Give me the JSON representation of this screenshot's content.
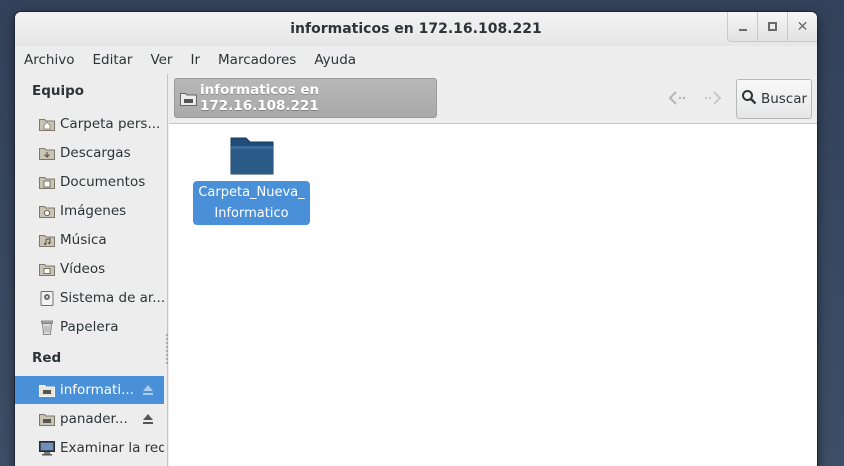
{
  "window": {
    "title": "informaticos en 172.16.108.221"
  },
  "window_controls": {
    "minimize": "–",
    "maximize": "□",
    "close": "✕"
  },
  "menu": [
    "Archivo",
    "Editar",
    "Ver",
    "Ir",
    "Marcadores",
    "Ayuda"
  ],
  "sidebar": {
    "sections": [
      {
        "title": "Equipo",
        "items": [
          {
            "label": "Carpeta pers...",
            "icon": "home-folder-icon"
          },
          {
            "label": "Descargas",
            "icon": "downloads-folder-icon"
          },
          {
            "label": "Documentos",
            "icon": "documents-folder-icon"
          },
          {
            "label": "Imágenes",
            "icon": "pictures-folder-icon"
          },
          {
            "label": "Música",
            "icon": "music-folder-icon"
          },
          {
            "label": "Vídeos",
            "icon": "videos-folder-icon"
          },
          {
            "label": "Sistema de ar...",
            "icon": "filesystem-icon"
          },
          {
            "label": "Papelera",
            "icon": "trash-icon"
          }
        ]
      },
      {
        "title": "Red",
        "items": [
          {
            "label": "informati...",
            "icon": "network-folder-icon",
            "selected": true,
            "eject": true
          },
          {
            "label": "panader...",
            "icon": "network-folder-icon",
            "selected": false,
            "eject": true
          },
          {
            "label": "Examinar la red",
            "icon": "network-browse-icon"
          }
        ]
      }
    ]
  },
  "toolbar": {
    "path_label": "informaticos en 172.16.108.221",
    "search_label": "Buscar"
  },
  "files": [
    {
      "name": "Carpeta_Nueva_Informatico",
      "line1": "Carpeta_Nueva_",
      "line2": "Informatico",
      "icon": "folder-icon",
      "selected": true
    }
  ],
  "colors": {
    "selection": "#4a90d9",
    "folder": "#2a5a86"
  }
}
